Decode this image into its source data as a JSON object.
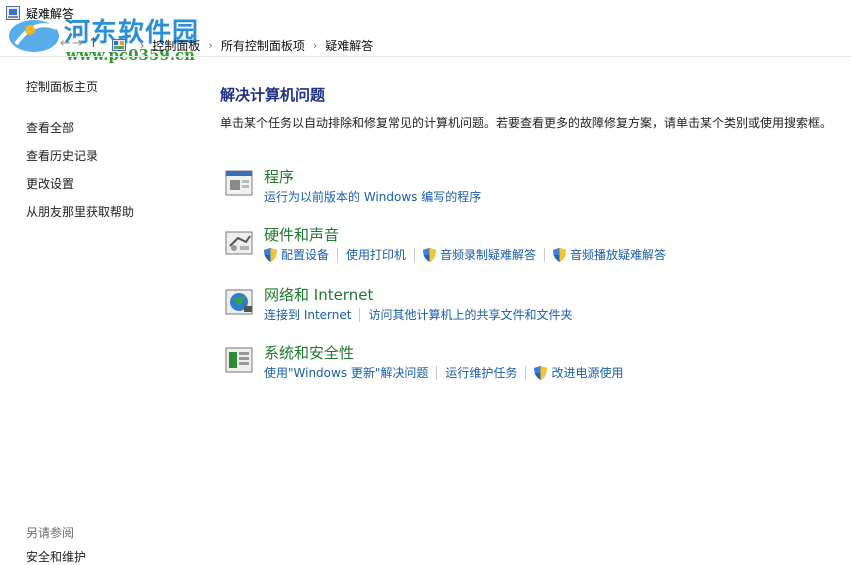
{
  "window": {
    "title": "疑难解答"
  },
  "watermark": {
    "name": "河东软件园",
    "url": "www.pc0359.cn"
  },
  "nav": {
    "back": "←",
    "forward": "→",
    "up": "↑",
    "breadcrumbs": [
      "控制面板",
      "所有控制面板项",
      "疑难解答"
    ]
  },
  "sidebar": {
    "home": "控制面板主页",
    "items": [
      "查看全部",
      "查看历史记录",
      "更改设置",
      "从朋友那里获取帮助"
    ],
    "see_also_title": "另请参阅",
    "see_also_items": [
      "安全和维护"
    ]
  },
  "main": {
    "title": "解决计算机问题",
    "description": "单击某个任务以自动排除和修复常见的计算机问题。若要查看更多的故障修复方案，请单击某个类别或使用搜索框。",
    "categories": [
      {
        "title": "程序",
        "icon": "program-icon",
        "links": [
          {
            "label": "运行为以前版本的 Windows 编写的程序",
            "shield": false
          }
        ]
      },
      {
        "title": "硬件和声音",
        "icon": "hardware-sound-icon",
        "links": [
          {
            "label": "配置设备",
            "shield": true
          },
          {
            "label": "使用打印机",
            "shield": false
          },
          {
            "label": "音频录制疑难解答",
            "shield": true
          },
          {
            "label": "音频播放疑难解答",
            "shield": true
          }
        ]
      },
      {
        "title": "网络和 Internet",
        "icon": "network-icon",
        "links": [
          {
            "label": "连接到 Internet",
            "shield": false
          },
          {
            "label": "访问其他计算机上的共享文件和文件夹",
            "shield": false
          }
        ]
      },
      {
        "title": "系统和安全性",
        "icon": "system-security-icon",
        "links": [
          {
            "label": "使用\"Windows 更新\"解决问题",
            "shield": false
          },
          {
            "label": "运行维护任务",
            "shield": false
          },
          {
            "label": "改进电源使用",
            "shield": true
          }
        ]
      }
    ]
  },
  "colors": {
    "category_title": "#1e7a2e",
    "link": "#1a5ea8",
    "heading": "#1e3287"
  }
}
